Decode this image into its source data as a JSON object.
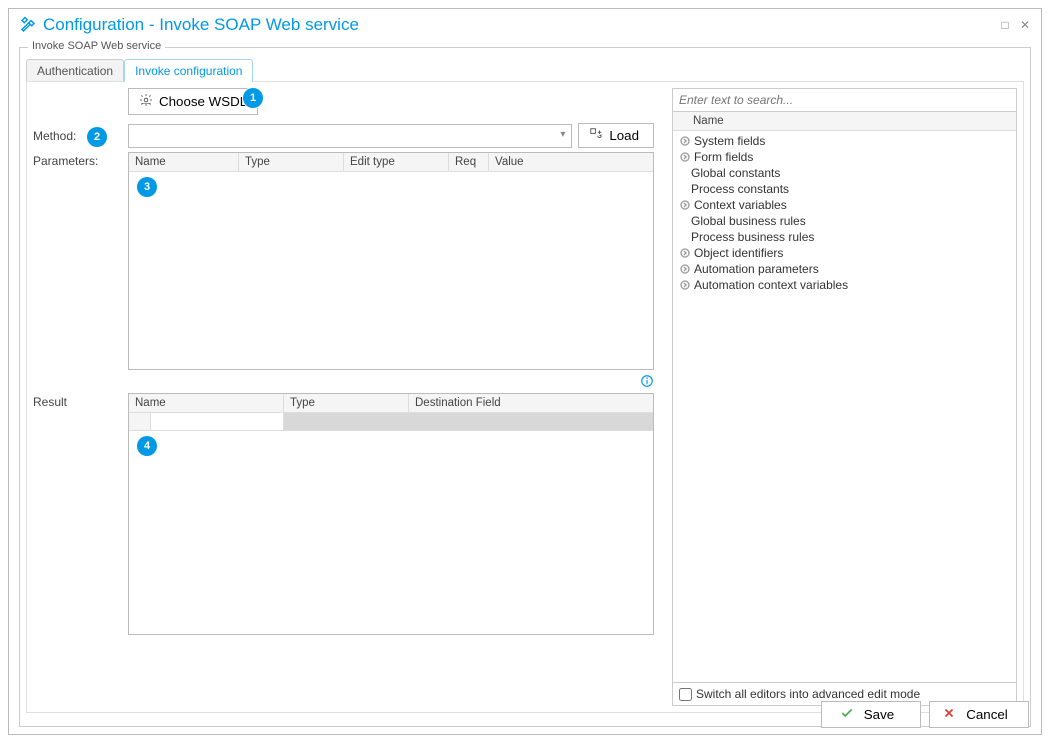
{
  "window": {
    "title": "Configuration - Invoke SOAP Web service"
  },
  "groupbox": {
    "label": "Invoke SOAP Web service"
  },
  "tabs": {
    "auth": "Authentication",
    "invoke": "Invoke configuration"
  },
  "labels": {
    "method": "Method:",
    "parameters": "Parameters:",
    "result": "Result"
  },
  "buttons": {
    "choose_wsdl": "Choose WSDL",
    "load": "Load",
    "save": "Save",
    "cancel": "Cancel"
  },
  "params_grid": {
    "headers": {
      "name": "Name",
      "type": "Type",
      "edit": "Edit type",
      "req": "Req",
      "value": "Value"
    }
  },
  "result_grid": {
    "headers": {
      "name": "Name",
      "type": "Type",
      "dest": "Destination Field"
    }
  },
  "right_panel": {
    "search_placeholder": "Enter text to search...",
    "header": "Name",
    "tree": {
      "system_fields": "System fields",
      "form_fields": "Form fields",
      "global_constants": "Global constants",
      "process_constants": "Process constants",
      "context_vars": "Context variables",
      "global_biz_rules": "Global business rules",
      "process_biz_rules": "Process business rules",
      "object_ids": "Object identifiers",
      "automation_params": "Automation parameters",
      "automation_ctx_vars": "Automation context variables"
    },
    "check_label": "Switch all editors into advanced edit mode"
  },
  "badges": {
    "b1": "1",
    "b2": "2",
    "b3": "3",
    "b4": "4"
  }
}
